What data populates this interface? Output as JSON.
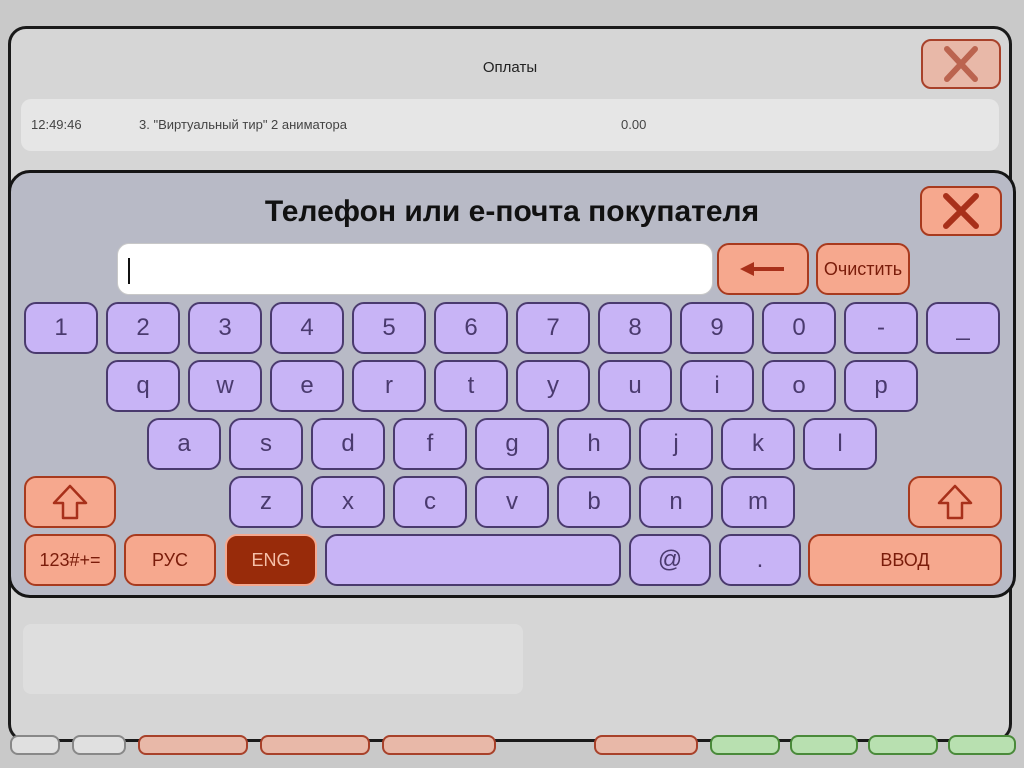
{
  "background_window": {
    "title": "Оплаты",
    "row": {
      "time": "12:49:46",
      "description": "3. \"Виртуальный тир\" 2 аниматора",
      "amount": "0.00"
    }
  },
  "keyboard": {
    "title": "Телефон или е-почта покупателя",
    "input_value": "",
    "clear_label": "Очистить",
    "row_digits": [
      "1",
      "2",
      "3",
      "4",
      "5",
      "6",
      "7",
      "8",
      "9",
      "0",
      "-",
      "_"
    ],
    "row_1": [
      "q",
      "w",
      "e",
      "r",
      "t",
      "y",
      "u",
      "i",
      "o",
      "p"
    ],
    "row_2": [
      "a",
      "s",
      "d",
      "f",
      "g",
      "h",
      "j",
      "k",
      "l"
    ],
    "row_3": [
      "z",
      "x",
      "c",
      "v",
      "b",
      "n",
      "m"
    ],
    "symbols_label": "123#+=",
    "rus_label": "РУС",
    "eng_label": "ENG",
    "at_label": "@",
    "dot_label": ".",
    "enter_label": "ВВОД",
    "active_layout": "ENG"
  },
  "colors": {
    "key_fill": "#c8b4f6",
    "key_border": "#4a3a6e",
    "action_fill": "#f6a88e",
    "action_border": "#a83a1e",
    "active_fill": "#982b0a",
    "panel": "#b8bac6"
  }
}
